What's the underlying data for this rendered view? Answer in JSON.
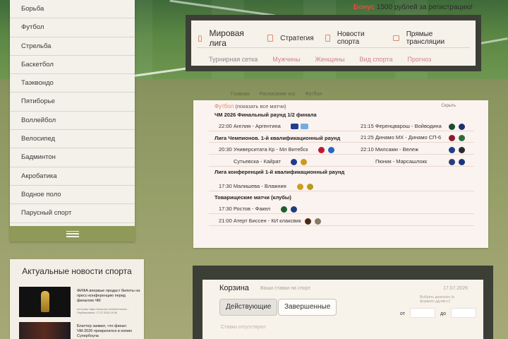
{
  "header": {
    "bonus_word": "Бонус",
    "bonus_text": "1500 рублей за регистрацию!"
  },
  "sport_menu": {
    "items": [
      "Борьба",
      "Футбол",
      "Стрельба",
      "Баскетбол",
      "Таэквондо",
      "Пятиборье",
      "Воллейбол",
      "Велосипед",
      "Бадминтон",
      "Акробатика",
      "Водное поло",
      "Парусный спорт"
    ]
  },
  "nav": {
    "primary": [
      {
        "label": "Мировая лига",
        "icon": "bulb-icon"
      },
      {
        "label": "Стратегия",
        "icon": "document-icon"
      },
      {
        "label": "Новости спорта",
        "icon": "page-icon"
      },
      {
        "label": "Прямые трансляции",
        "icon": "folder-icon"
      }
    ],
    "secondary": [
      "Турнирная сетка",
      "Мужчины",
      "Женщины",
      "Вид спорта",
      "Прогноз"
    ]
  },
  "breadcrumb": [
    "Главная",
    "Расписание игр",
    "Футбол"
  ],
  "matches": {
    "sport": "Футбол",
    "show_all": "(показать все матчи)",
    "hide": "Скрыть",
    "leagues": [
      {
        "name": "ЧМ 2026 Финальный раунд 1/2 финала",
        "rows": [
          {
            "left": "22:00 Англия - Аргентина",
            "left_logos": [
              "#1f3f8f",
              "#74acdf"
            ],
            "right": "21:15 Ференцварош - Войводина",
            "right_logos": [
              "#1a4d2e",
              "#1d2f6b"
            ]
          }
        ]
      },
      {
        "name": "Лига Чемпионов. 1-й квалификационный раунд",
        "rows": [
          {
            "left": "",
            "left_logos": [],
            "right": "21:25 Динамо МХ - Динамо СП-6",
            "right_logos": [
              "#8a1c2a",
              "#2f6b3a"
            ]
          },
          {
            "left": "20:30 Университата Кр - Мл Витебск",
            "left_logos": [
              "#c0182b",
              "#2566c4"
            ],
            "right": "22:10 Милсами - Вележ",
            "right_logos": [
              "#1e3e8a",
              "#2b2b2b"
            ]
          },
          {
            "left": "Сутьевска - Кайрат",
            "left_logos": [
              "#1d3c8c",
              "#c99a22"
            ],
            "right": "Пюник - Марсашлокк",
            "right_logos": [
              "#2d3d78",
              "#1b3480"
            ]
          }
        ]
      },
      {
        "name": "Лига конференций 1-й квалификационный раунд",
        "rows": [
          {
            "left": "17:30 Малишева - Влажния",
            "left_logos": [
              "#c9a020",
              "#b79b1e"
            ],
            "right": "",
            "right_logos": []
          }
        ]
      },
      {
        "name": "Товарищеские матчи (клубы)",
        "rows": [
          {
            "left": "17:30 Ростов - Факел",
            "left_logos": [
              "#1d5f2e",
              "#1d3d7d"
            ],
            "right": "",
            "right_logos": []
          },
          {
            "left": "21:00 Атерт Биссен - КИ клаксвик",
            "left_logos": [
              "#4a2a1a",
              "#8a7a60"
            ],
            "right": "",
            "right_logos": []
          }
        ]
      }
    ]
  },
  "news": {
    "title": "Актуальные новости спорта",
    "items": [
      {
        "text": "ФИФА впервые продаст билеты на пресс-конференцию перед финалом ЧМ",
        "meta": "источник: https://www.rbc.ru/rbcfreenews/...  Опубликовано: 17.07.2026 18:36"
      },
      {
        "text": "Блаттер заявил, что финал ЧМ-2026 превратился в копию Супербоула",
        "meta": ""
      }
    ]
  },
  "basket": {
    "title": "Корзина",
    "subtitle": "Ваши ставки на спорт",
    "date": "17.07.2026",
    "date_hint": "Выбрать диапазон (в формате дд.мм.гг)",
    "tab_active": "Действующие",
    "tab_inactive": "Завершенные",
    "from_label": "от",
    "to_label": "до",
    "empty": "Ставки отсутствуют"
  }
}
